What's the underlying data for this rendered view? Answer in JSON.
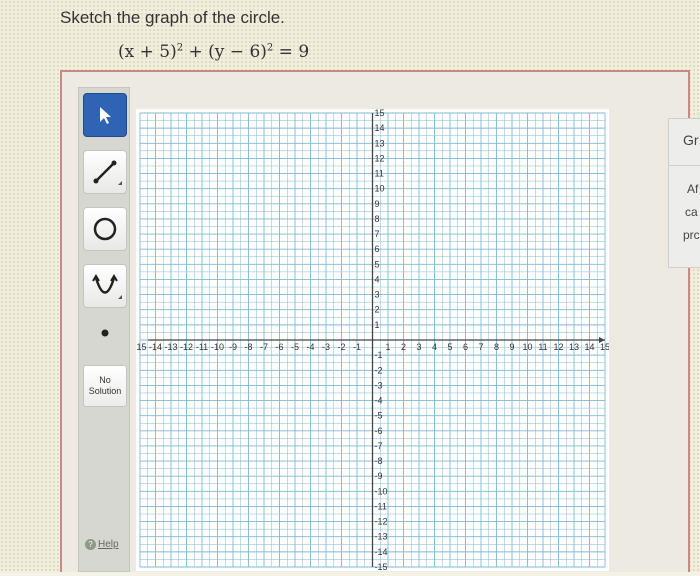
{
  "prompt": "Sketch the graph of the circle.",
  "equation": {
    "left": "(x + 5)",
    "exp1": "2",
    "middle": " + (y − 6)",
    "exp2": "2",
    "right": " = 9"
  },
  "toolbar": {
    "tools": [
      {
        "name": "select-arrow-icon"
      },
      {
        "name": "line-segment-icon"
      },
      {
        "name": "circle-icon"
      },
      {
        "name": "parabola-icon"
      },
      {
        "name": "point-icon"
      }
    ],
    "no_solution_line1": "No",
    "no_solution_line2": "Solution",
    "help_label": "Help"
  },
  "graph": {
    "x_range": [
      -15,
      15
    ],
    "y_range": [
      -15,
      15
    ],
    "x_tick_labels": [
      "-15",
      "-14",
      "-13",
      "-12",
      "-11",
      "-10",
      "-9",
      "-8",
      "-7",
      "-6",
      "-5",
      "-4",
      "-3",
      "-2",
      "-1",
      "1",
      "2",
      "3",
      "4",
      "5",
      "6",
      "7",
      "8",
      "9",
      "10",
      "11",
      "12",
      "13",
      "14",
      "15"
    ],
    "y_tick_labels": [
      "15",
      "14",
      "13",
      "12",
      "11",
      "10",
      "9",
      "8",
      "7",
      "6",
      "5",
      "4",
      "3",
      "2",
      "1",
      "-1",
      "-2",
      "-3",
      "-4",
      "-5",
      "-6",
      "-7",
      "-8",
      "-9",
      "-10",
      "-11",
      "-12",
      "-13",
      "-14",
      "-15"
    ],
    "minor_per_unit": 2,
    "grid_color": "#7fb8d6",
    "axis_color": "#444444",
    "background": "#ffffff"
  },
  "side_panel": {
    "title": "Gr",
    "line1": "Af",
    "line2": "ca",
    "line3": "prc"
  }
}
